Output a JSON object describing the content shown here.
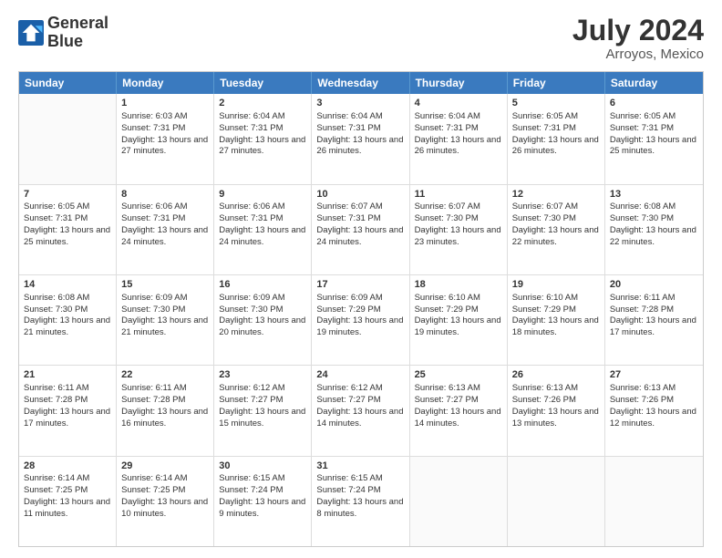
{
  "logo": {
    "line1": "General",
    "line2": "Blue"
  },
  "title": "July 2024",
  "subtitle": "Arroyos, Mexico",
  "header_days": [
    "Sunday",
    "Monday",
    "Tuesday",
    "Wednesday",
    "Thursday",
    "Friday",
    "Saturday"
  ],
  "weeks": [
    [
      {
        "day": "",
        "sunrise": "",
        "sunset": "",
        "daylight": ""
      },
      {
        "day": "1",
        "sunrise": "Sunrise: 6:03 AM",
        "sunset": "Sunset: 7:31 PM",
        "daylight": "Daylight: 13 hours and 27 minutes."
      },
      {
        "day": "2",
        "sunrise": "Sunrise: 6:04 AM",
        "sunset": "Sunset: 7:31 PM",
        "daylight": "Daylight: 13 hours and 27 minutes."
      },
      {
        "day": "3",
        "sunrise": "Sunrise: 6:04 AM",
        "sunset": "Sunset: 7:31 PM",
        "daylight": "Daylight: 13 hours and 26 minutes."
      },
      {
        "day": "4",
        "sunrise": "Sunrise: 6:04 AM",
        "sunset": "Sunset: 7:31 PM",
        "daylight": "Daylight: 13 hours and 26 minutes."
      },
      {
        "day": "5",
        "sunrise": "Sunrise: 6:05 AM",
        "sunset": "Sunset: 7:31 PM",
        "daylight": "Daylight: 13 hours and 26 minutes."
      },
      {
        "day": "6",
        "sunrise": "Sunrise: 6:05 AM",
        "sunset": "Sunset: 7:31 PM",
        "daylight": "Daylight: 13 hours and 25 minutes."
      }
    ],
    [
      {
        "day": "7",
        "sunrise": "Sunrise: 6:05 AM",
        "sunset": "Sunset: 7:31 PM",
        "daylight": "Daylight: 13 hours and 25 minutes."
      },
      {
        "day": "8",
        "sunrise": "Sunrise: 6:06 AM",
        "sunset": "Sunset: 7:31 PM",
        "daylight": "Daylight: 13 hours and 24 minutes."
      },
      {
        "day": "9",
        "sunrise": "Sunrise: 6:06 AM",
        "sunset": "Sunset: 7:31 PM",
        "daylight": "Daylight: 13 hours and 24 minutes."
      },
      {
        "day": "10",
        "sunrise": "Sunrise: 6:07 AM",
        "sunset": "Sunset: 7:31 PM",
        "daylight": "Daylight: 13 hours and 24 minutes."
      },
      {
        "day": "11",
        "sunrise": "Sunrise: 6:07 AM",
        "sunset": "Sunset: 7:30 PM",
        "daylight": "Daylight: 13 hours and 23 minutes."
      },
      {
        "day": "12",
        "sunrise": "Sunrise: 6:07 AM",
        "sunset": "Sunset: 7:30 PM",
        "daylight": "Daylight: 13 hours and 22 minutes."
      },
      {
        "day": "13",
        "sunrise": "Sunrise: 6:08 AM",
        "sunset": "Sunset: 7:30 PM",
        "daylight": "Daylight: 13 hours and 22 minutes."
      }
    ],
    [
      {
        "day": "14",
        "sunrise": "Sunrise: 6:08 AM",
        "sunset": "Sunset: 7:30 PM",
        "daylight": "Daylight: 13 hours and 21 minutes."
      },
      {
        "day": "15",
        "sunrise": "Sunrise: 6:09 AM",
        "sunset": "Sunset: 7:30 PM",
        "daylight": "Daylight: 13 hours and 21 minutes."
      },
      {
        "day": "16",
        "sunrise": "Sunrise: 6:09 AM",
        "sunset": "Sunset: 7:30 PM",
        "daylight": "Daylight: 13 hours and 20 minutes."
      },
      {
        "day": "17",
        "sunrise": "Sunrise: 6:09 AM",
        "sunset": "Sunset: 7:29 PM",
        "daylight": "Daylight: 13 hours and 19 minutes."
      },
      {
        "day": "18",
        "sunrise": "Sunrise: 6:10 AM",
        "sunset": "Sunset: 7:29 PM",
        "daylight": "Daylight: 13 hours and 19 minutes."
      },
      {
        "day": "19",
        "sunrise": "Sunrise: 6:10 AM",
        "sunset": "Sunset: 7:29 PM",
        "daylight": "Daylight: 13 hours and 18 minutes."
      },
      {
        "day": "20",
        "sunrise": "Sunrise: 6:11 AM",
        "sunset": "Sunset: 7:28 PM",
        "daylight": "Daylight: 13 hours and 17 minutes."
      }
    ],
    [
      {
        "day": "21",
        "sunrise": "Sunrise: 6:11 AM",
        "sunset": "Sunset: 7:28 PM",
        "daylight": "Daylight: 13 hours and 17 minutes."
      },
      {
        "day": "22",
        "sunrise": "Sunrise: 6:11 AM",
        "sunset": "Sunset: 7:28 PM",
        "daylight": "Daylight: 13 hours and 16 minutes."
      },
      {
        "day": "23",
        "sunrise": "Sunrise: 6:12 AM",
        "sunset": "Sunset: 7:27 PM",
        "daylight": "Daylight: 13 hours and 15 minutes."
      },
      {
        "day": "24",
        "sunrise": "Sunrise: 6:12 AM",
        "sunset": "Sunset: 7:27 PM",
        "daylight": "Daylight: 13 hours and 14 minutes."
      },
      {
        "day": "25",
        "sunrise": "Sunrise: 6:13 AM",
        "sunset": "Sunset: 7:27 PM",
        "daylight": "Daylight: 13 hours and 14 minutes."
      },
      {
        "day": "26",
        "sunrise": "Sunrise: 6:13 AM",
        "sunset": "Sunset: 7:26 PM",
        "daylight": "Daylight: 13 hours and 13 minutes."
      },
      {
        "day": "27",
        "sunrise": "Sunrise: 6:13 AM",
        "sunset": "Sunset: 7:26 PM",
        "daylight": "Daylight: 13 hours and 12 minutes."
      }
    ],
    [
      {
        "day": "28",
        "sunrise": "Sunrise: 6:14 AM",
        "sunset": "Sunset: 7:25 PM",
        "daylight": "Daylight: 13 hours and 11 minutes."
      },
      {
        "day": "29",
        "sunrise": "Sunrise: 6:14 AM",
        "sunset": "Sunset: 7:25 PM",
        "daylight": "Daylight: 13 hours and 10 minutes."
      },
      {
        "day": "30",
        "sunrise": "Sunrise: 6:15 AM",
        "sunset": "Sunset: 7:24 PM",
        "daylight": "Daylight: 13 hours and 9 minutes."
      },
      {
        "day": "31",
        "sunrise": "Sunrise: 6:15 AM",
        "sunset": "Sunset: 7:24 PM",
        "daylight": "Daylight: 13 hours and 8 minutes."
      },
      {
        "day": "",
        "sunrise": "",
        "sunset": "",
        "daylight": ""
      },
      {
        "day": "",
        "sunrise": "",
        "sunset": "",
        "daylight": ""
      },
      {
        "day": "",
        "sunrise": "",
        "sunset": "",
        "daylight": ""
      }
    ]
  ]
}
